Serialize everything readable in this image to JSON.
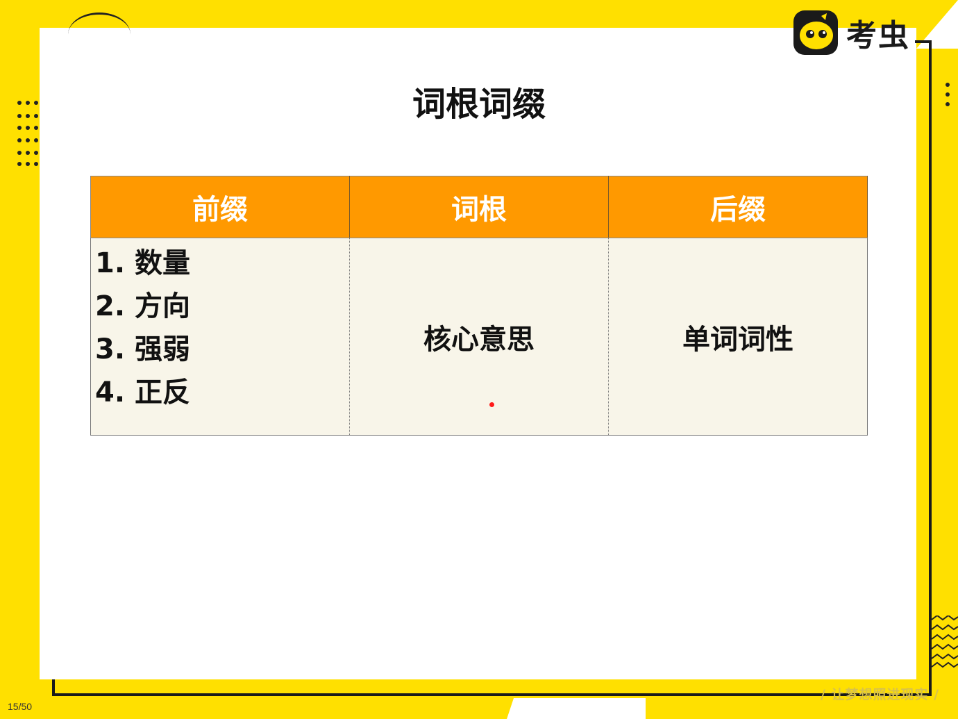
{
  "brand": {
    "name": "考虫",
    "icon": "bee-face-icon"
  },
  "title": "词根词缀",
  "table": {
    "headers": [
      "前缀",
      "词根",
      "后缀"
    ],
    "prefix_items": [
      "1. 数量",
      "2. 方向",
      "3. 强弱",
      "4. 正反"
    ],
    "root_text": "核心意思",
    "suffix_text": "单词词性"
  },
  "footer": {
    "page_counter": "15/50",
    "slogan": "/ 让梦想照进现实 /"
  },
  "colors": {
    "background": "#FFE000",
    "header_fill": "#FF9900",
    "cell_fill": "#F8F5E9"
  }
}
